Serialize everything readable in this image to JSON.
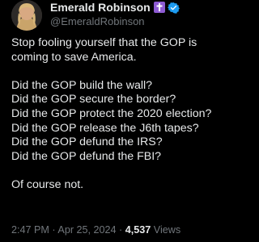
{
  "author": {
    "display_name": "Emerald Robinson",
    "handle": "@EmeraldRobinson",
    "badge_icon": "cross-badge-icon",
    "verified_icon": "verified-check-icon",
    "badge_color": "#8e5bd3",
    "verified_color": "#1d9bf0"
  },
  "tweet": {
    "intro_line1": "Stop fooling yourself that the GOP is",
    "intro_line2": "coming to save America.",
    "questions": [
      "Did the GOP build the wall?",
      "Did the GOP secure the border?",
      "Did the GOP protect the 2020 election?",
      "Did the GOP release the J6th tapes?",
      "Did the GOP defund the IRS?",
      "Did the GOP defund the FBI?"
    ],
    "conclusion": "Of course not."
  },
  "meta": {
    "time": "2:47 PM",
    "separator": "·",
    "date": "Apr 25, 2024",
    "views_count": "4,537",
    "views_label": "Views"
  },
  "colors": {
    "background": "#000000",
    "text": "#e7e9ea",
    "secondary_text": "#71767b"
  }
}
